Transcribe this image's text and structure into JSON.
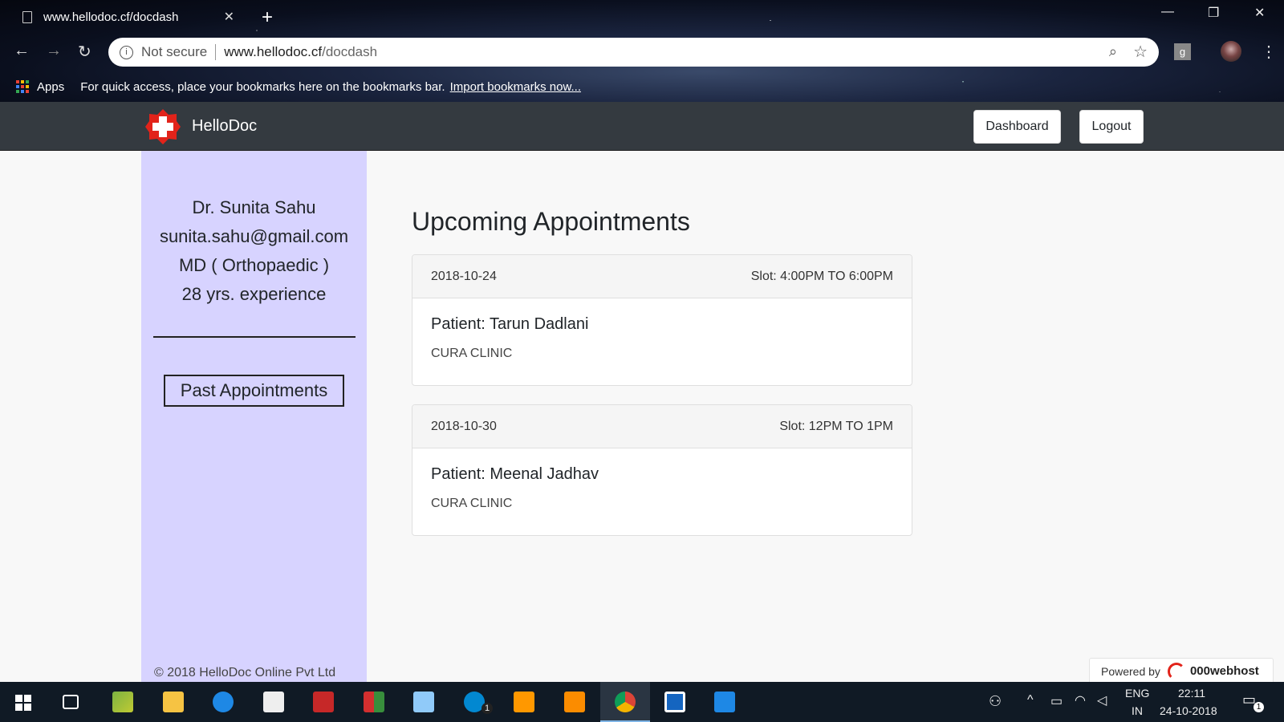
{
  "browser": {
    "tab_title": "www.hellodoc.cf/docdash",
    "security_label": "Not secure",
    "url_domain": "www.hellodoc.cf",
    "url_path": "/docdash",
    "bookmarks_apps": "Apps",
    "bookmarks_hint": "For quick access, place your bookmarks here on the bookmarks bar.",
    "bookmarks_import": "Import bookmarks now...",
    "extension_letter": "g"
  },
  "navbar": {
    "brand": "HelloDoc",
    "dashboard_label": "Dashboard",
    "logout_label": "Logout",
    "logo_color": "#e2231a"
  },
  "doctor": {
    "name": "Dr. Sunita Sahu",
    "email": "sunita.sahu@gmail.com",
    "degree": "MD ( Orthopaedic )",
    "experience": "28 yrs. experience"
  },
  "sidebar": {
    "past_appointments_label": "Past Appointments",
    "footer": "© 2018 HelloDoc Online Pvt Ltd",
    "background": "#d7d3ff"
  },
  "main": {
    "title": "Upcoming Appointments",
    "appointments": [
      {
        "date": "2018-10-24",
        "slot": "Slot: 4:00PM TO 6:00PM",
        "patient": "Patient: Tarun Dadlani",
        "clinic": "CURA CLINIC"
      },
      {
        "date": "2018-10-30",
        "slot": "Slot: 12PM TO 1PM",
        "patient": "Patient: Meenal Jadhav",
        "clinic": "CURA CLINIC"
      }
    ]
  },
  "powered": {
    "label": "Powered by",
    "host": "000webhost"
  },
  "taskbar": {
    "lang_top": "ENG",
    "lang_bottom": "IN",
    "time": "22:11",
    "date": "24-10-2018",
    "notification_count": "1",
    "skype_badge": "1"
  }
}
